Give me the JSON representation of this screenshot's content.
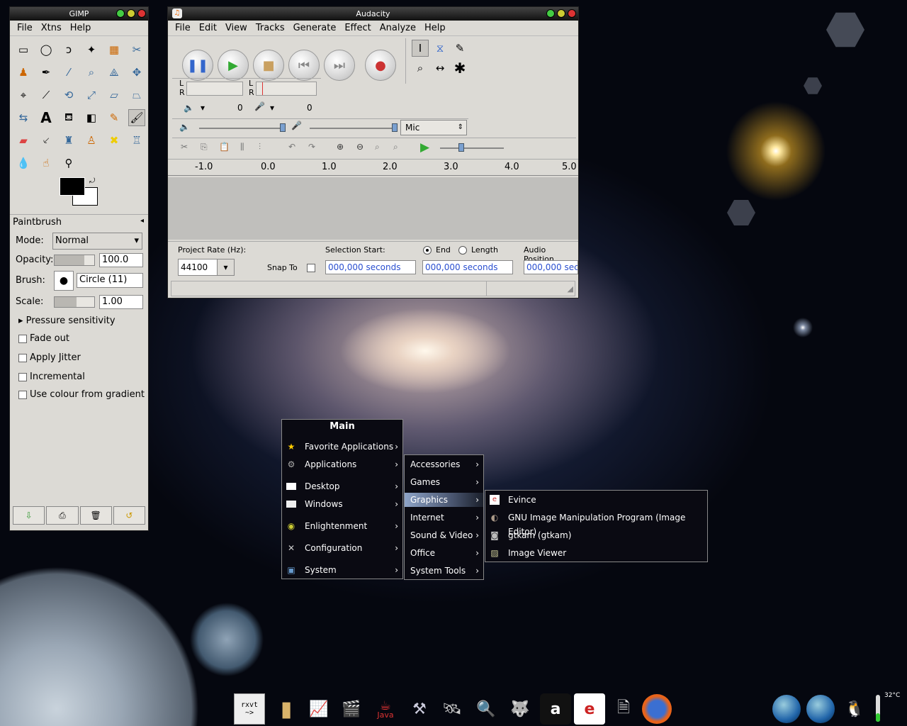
{
  "gimp": {
    "title": "GIMP",
    "menu": [
      "File",
      "Xtns",
      "Help"
    ],
    "tool_options": {
      "title": "Paintbrush",
      "mode_label": "Mode:",
      "mode_value": "Normal",
      "opacity_label": "Opacity:",
      "opacity_value": "100.0",
      "brush_label": "Brush:",
      "brush_value": "Circle (11)",
      "scale_label": "Scale:",
      "scale_value": "1.00",
      "pressure_label": "Pressure sensitivity",
      "fade_label": "Fade out",
      "jitter_label": "Apply Jitter",
      "incremental_label": "Incremental",
      "gradient_label": "Use colour from gradient"
    },
    "fg_color": "#000000",
    "bg_color": "#ffffff"
  },
  "audacity": {
    "title": "Audacity",
    "menu": [
      "File",
      "Edit",
      "View",
      "Tracks",
      "Generate",
      "Effect",
      "Analyze",
      "Help"
    ],
    "meter_l": "L",
    "meter_r": "R",
    "volume_zero": "0",
    "mic_zero": "0",
    "input_source": "Mic",
    "ruler": [
      "-1.0",
      "0.0",
      "1.0",
      "2.0",
      "3.0",
      "4.0",
      "5.0"
    ],
    "project_rate_label": "Project Rate (Hz):",
    "project_rate_value": "44100",
    "snap_label": "Snap To",
    "selection_start_label": "Selection Start:",
    "end_label": "End",
    "length_label": "Length",
    "audio_position_label": "Audio Position",
    "sel_start_value": "000,000 seconds",
    "sel_end_value": "000,000 seconds",
    "audio_pos_value": "000,000 s"
  },
  "main_menu": {
    "title": "Main",
    "items": [
      "Favorite Applications",
      "Applications",
      "Desktop",
      "Windows",
      "Enlightenment",
      "Configuration",
      "System"
    ]
  },
  "apps_menu": {
    "items": [
      "Accessories",
      "Games",
      "Graphics",
      "Internet",
      "Sound & Video",
      "Office",
      "System Tools"
    ]
  },
  "graphics_menu": {
    "items": [
      "Evince",
      "GNU Image Manipulation Program (Image Editor)",
      "gtkam (gtkam)",
      "Image Viewer"
    ]
  },
  "taskbar": {
    "rxvt_label": "rxvt",
    "java_label": "Java",
    "temperature": "32°C"
  }
}
